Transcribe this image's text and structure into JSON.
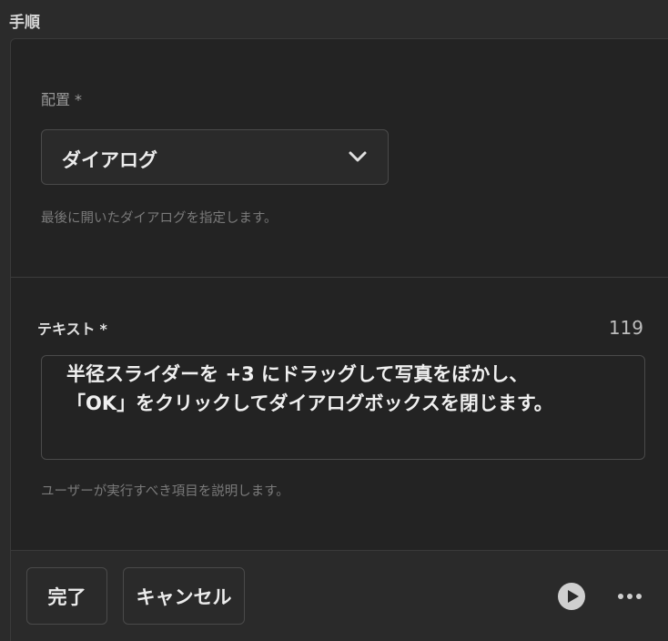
{
  "panel": {
    "title": "手順"
  },
  "placement": {
    "label": "配置",
    "required_mark": "*",
    "selected_value": "ダイアログ",
    "hint": "最後に開いたダイアログを指定します。"
  },
  "text_field": {
    "label": "テキスト",
    "required_mark": "*",
    "char_count": "119",
    "value": "半径スライダーを +3 にドラッグして写真をぼかし、\n「OK」をクリックしてダイアログボックスを閉じます。",
    "hint": "ユーザーが実行すべき項目を説明します。"
  },
  "footer": {
    "done_label": "完了",
    "cancel_label": "キャンセル",
    "play_icon": "play-icon",
    "more_icon": "more-icon"
  },
  "colors": {
    "background": "#2b2b2b",
    "card": "#232323",
    "border": "#4a4a4a"
  }
}
